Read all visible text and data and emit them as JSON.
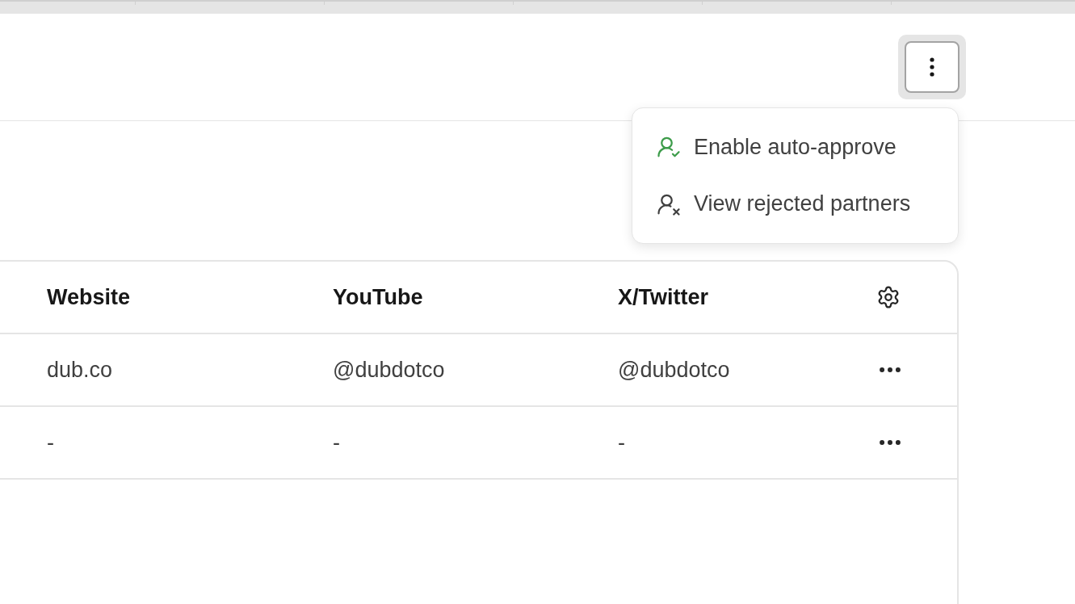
{
  "menu": {
    "items": [
      {
        "kind": "approve",
        "label": "Enable auto-approve"
      },
      {
        "kind": "reject",
        "label": "View rejected partners"
      }
    ]
  },
  "table": {
    "columns": [
      "Website",
      "YouTube",
      "X/Twitter"
    ],
    "rows": [
      {
        "cells": [
          "dub.co",
          "@dubdotco",
          "@dubdotco"
        ]
      },
      {
        "cells": [
          "-",
          "-",
          "-"
        ]
      }
    ]
  }
}
